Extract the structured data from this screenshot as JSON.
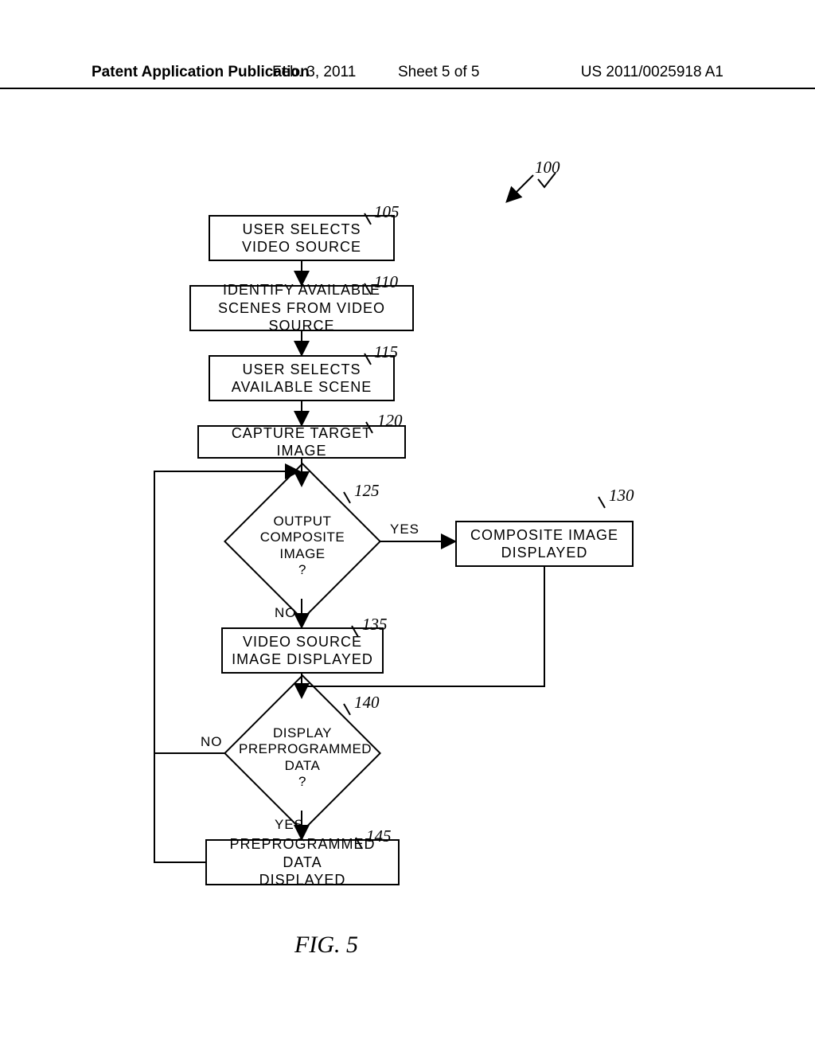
{
  "header": {
    "left": "Patent Application Publication",
    "date": "Feb. 3, 2011",
    "sheet": "Sheet 5 of 5",
    "pubno": "US 2011/0025918 A1"
  },
  "refs": {
    "fig": "100",
    "b105": "105",
    "b110": "110",
    "b115": "115",
    "b120": "120",
    "d125": "125",
    "b130": "130",
    "b135": "135",
    "d140": "140",
    "b145": "145"
  },
  "boxes": {
    "b105": "USER SELECTS\nVIDEO SOURCE",
    "b110": "IDENTIFY AVAILABLE\nSCENES FROM VIDEO SOURCE",
    "b115": "USER SELECTS\nAVAILABLE SCENE",
    "b120": "CAPTURE TARGET IMAGE",
    "b130": "COMPOSITE IMAGE\nDISPLAYED",
    "b135": "VIDEO SOURCE\nIMAGE DISPLAYED",
    "b145": "PREPROGRAMMED DATA\nDISPLAYED"
  },
  "diamonds": {
    "d125": "OUTPUT\nCOMPOSITE\nIMAGE\n?",
    "d140": "DISPLAY\nPREPROGRAMMED\nDATA\n?"
  },
  "labels": {
    "yes125": "YES",
    "no125": "NO",
    "yes140": "YES",
    "no140": "NO"
  },
  "figure": "FIG. 5"
}
